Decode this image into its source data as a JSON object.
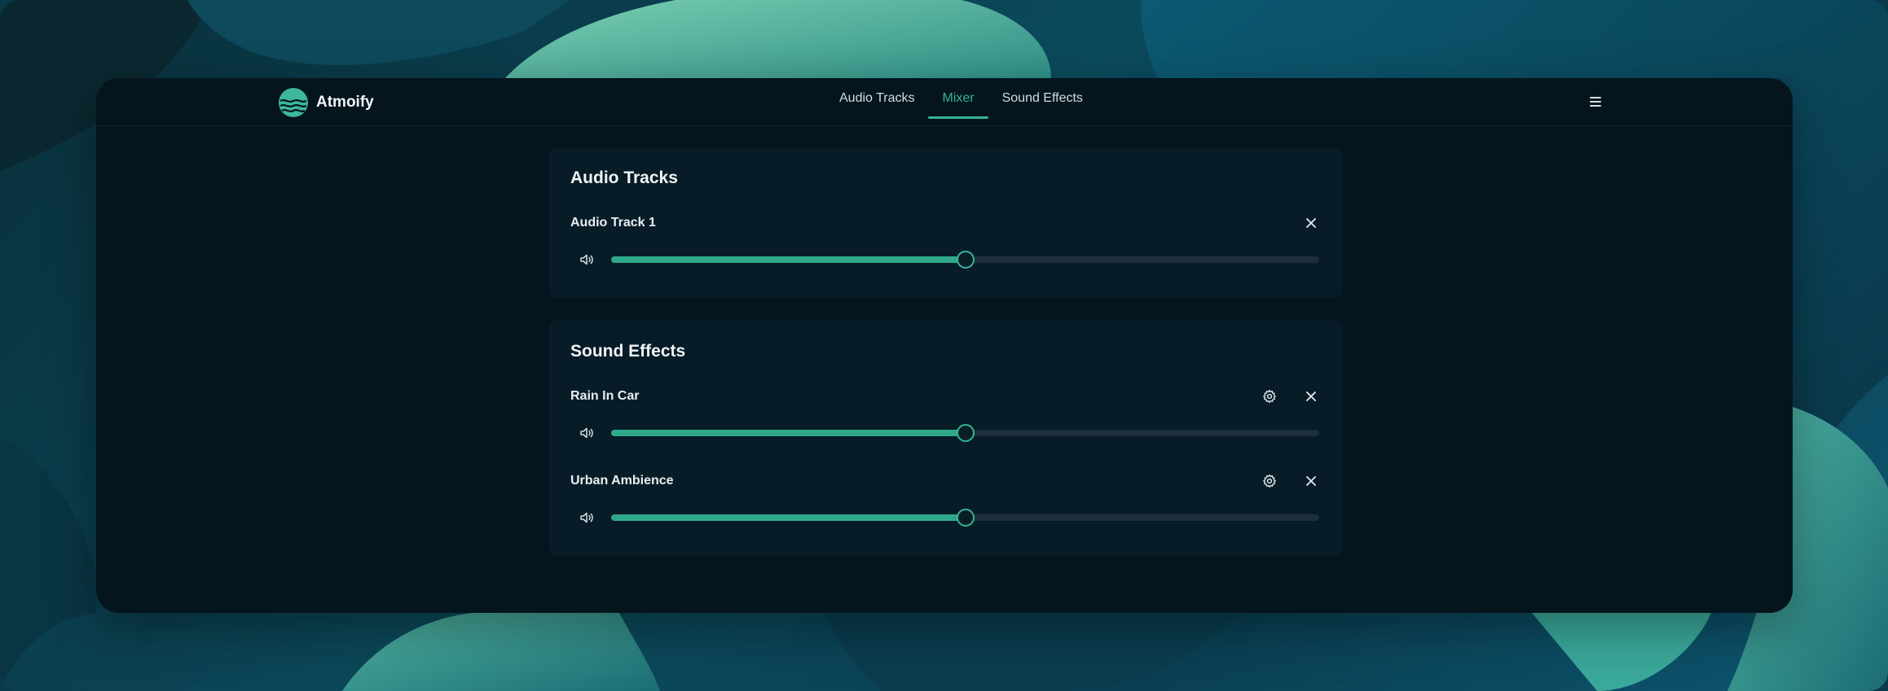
{
  "app": {
    "name": "Atmoify"
  },
  "nav": {
    "tabs": [
      {
        "label": "Audio Tracks",
        "active": false
      },
      {
        "label": "Mixer",
        "active": true
      },
      {
        "label": "Sound Effects",
        "active": false
      }
    ],
    "menu_icon": "hamburger-menu-icon"
  },
  "audio_tracks": {
    "title": "Audio Tracks",
    "items": [
      {
        "name": "Audio Track 1",
        "volume": 0.5
      }
    ]
  },
  "sound_effects": {
    "title": "Sound Effects",
    "items": [
      {
        "name": "Rain In Car",
        "volume": 0.5
      },
      {
        "name": "Urban Ambience",
        "volume": 0.5
      }
    ]
  },
  "colors": {
    "accent": "#35b596",
    "fill": "#2fa98a",
    "window_bg": "#04151d",
    "card_bg": "#081c28",
    "track_bg": "#1c2f3a"
  },
  "icons": {
    "speaker": "volume-icon",
    "settings": "gear-icon",
    "remove": "close-icon"
  }
}
